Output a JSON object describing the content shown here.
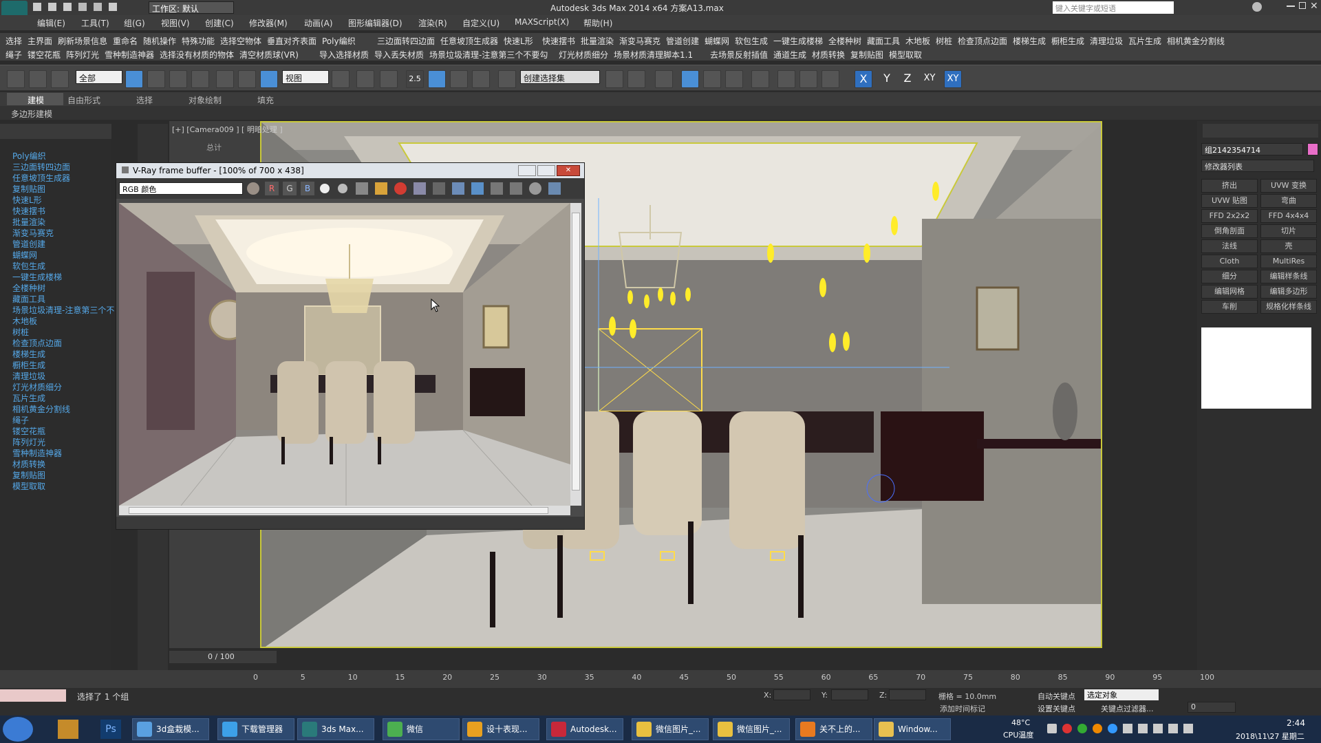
{
  "app": {
    "title": "Autodesk 3ds Max  2014 x64      方案A13.max",
    "workspace": "工作区: 默认",
    "search_placeholder": "键入关键字或短语"
  },
  "menu": [
    "编辑(E)",
    "工具(T)",
    "组(G)",
    "视图(V)",
    "创建(C)",
    "修改器(M)",
    "动画(A)",
    "图形编辑器(D)",
    "渲染(R)",
    "自定义(U)",
    "MAXScript(X)",
    "帮助(H)"
  ],
  "plugins_row1": [
    "选择",
    "主界面",
    "刷新场景信息",
    "重命名",
    "随机操作",
    "特殊功能",
    "选择空物体",
    "垂直对齐表面",
    "Poly编织",
    "三边面转四边面",
    "任意坡顶生成器",
    "快速L形",
    "快速摆书",
    "批量渲染",
    "渐变马赛克",
    "管道创建",
    "蝴蝶网",
    "软包生成",
    "一键生成楼梯",
    "全楼种树",
    "藏面工具",
    "木地板",
    "树桩",
    "检查顶点边面",
    "楼梯生成",
    "橱柜生成",
    "清理垃圾",
    "瓦片生成",
    "相机黄金分割线"
  ],
  "plugins_row2": [
    "绳子",
    "镂空花瓶",
    "阵列灯光",
    "雪种制造神器",
    "选择没有材质的物体",
    "清空材质球(VR)",
    "导入选择材质",
    "导入丢失材质",
    "场景垃圾清理-注意第三个不要勾",
    "灯光材质细分",
    "场景材质清理脚本1.1",
    "去场景反射插值",
    "通道生成",
    "材质转换",
    "复制贴图",
    "模型取取"
  ],
  "toolbar": {
    "select_filter": "全部",
    "ref_coord": "视图",
    "named_sel": "创建选择集",
    "axis": [
      "X",
      "Y",
      "Z",
      "XY",
      "XY"
    ],
    "num25": "2.5"
  },
  "ribbon": {
    "tabs": [
      "建模",
      "自由形式",
      "选择",
      "对象绘制",
      "填充"
    ],
    "sub": "多边形建模"
  },
  "left_panel": [
    "Poly编织",
    "三边面转四边面",
    "任意坡顶生成器",
    "复制贴图",
    "快速L形",
    "快速摆书",
    "批量渲染",
    "渐变马赛克",
    "管道创建",
    "蝴蝶网",
    "软包生成",
    "一键生成楼梯",
    "全楼种树",
    "藏面工具",
    "场景垃圾清理-注意第三个不",
    "木地板",
    "树桩",
    "检查顶点边面",
    "楼梯生成",
    "橱柜生成",
    "清理垃圾",
    "灯光材质细分",
    "瓦片生成",
    "相机黄金分割线",
    "绳子",
    "镂空花瓶",
    "阵列灯光",
    "雪种制造神器",
    "材质转换",
    "复制贴图",
    "模型取取"
  ],
  "viewport": {
    "label": "[+] [Camera009 ] [ 明暗处理 ]",
    "stat": "总计"
  },
  "vfb": {
    "title": "V-Ray frame buffer - [100% of 700 x 438]",
    "channel": "RGB 颜色",
    "rgb": [
      "R",
      "G",
      "B"
    ]
  },
  "right_panel": {
    "object_name": "组2142354714",
    "modifier_list": "修改器列表",
    "buttons": [
      "挤出",
      "UVW 变换",
      "UVW 贴图",
      "弯曲",
      "FFD 2x2x2",
      "FFD 4x4x4",
      "倒角剖面",
      "切片",
      "法线",
      "壳",
      "Cloth",
      "MultiRes",
      "细分",
      "编辑样条线",
      "编辑网格",
      "编辑多边形",
      "车削",
      "规格化样条线"
    ],
    "accent": "#e86ec8"
  },
  "timeline": {
    "frame": "0 / 100",
    "ticks": [
      "0",
      "5",
      "10",
      "15",
      "20",
      "25",
      "30",
      "35",
      "40",
      "45",
      "50",
      "55",
      "60",
      "65",
      "70",
      "75",
      "80",
      "85",
      "90",
      "95",
      "100"
    ]
  },
  "status": {
    "selection": "选择了 1 个组",
    "x_label": "X:",
    "y_label": "Y:",
    "z_label": "Z:",
    "grid": "栅格 = 10.0mm",
    "auto_key": "自动关键点",
    "set_key": "设置关键点",
    "key_filter": "关键点过滤器...",
    "selected": "选定对象",
    "add_time_tag": "添加时间标记",
    "frame_field": "0"
  },
  "taskbar": {
    "items": [
      "3d盒栽模...",
      "下载管理器",
      "3ds Max...",
      "微信",
      "设十表现...",
      "Autodesk...",
      "微信图片_...",
      "微信图片_...",
      "关不上的...",
      "Window..."
    ],
    "temp": "48°C",
    "temp_label": "CPU温度",
    "time": "2:44",
    "date": "2018\\11\\27 星期二"
  }
}
